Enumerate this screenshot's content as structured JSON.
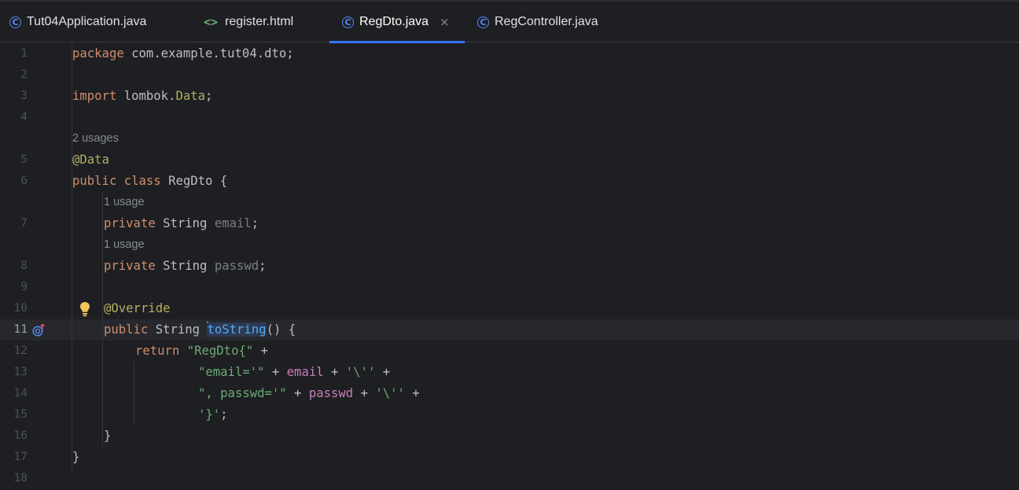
{
  "tabs": [
    {
      "label": "Tut04Application.java",
      "icon": "java-class-icon",
      "active": false
    },
    {
      "label": "register.html",
      "icon": "html-file-icon",
      "active": false
    },
    {
      "label": "RegDto.java",
      "icon": "java-class-icon",
      "active": true,
      "close": "×"
    },
    {
      "label": "RegController.java",
      "icon": "java-class-icon",
      "active": false
    }
  ],
  "class_icon_glyph": "C",
  "html_icon_glyph": "<>",
  "editor": {
    "current_line": 11,
    "line_numbers": [
      "1",
      "2",
      "3",
      "4",
      "5",
      "6",
      "7",
      "8",
      "9",
      "10",
      "11",
      "12",
      "13",
      "14",
      "15",
      "16",
      "17",
      "18"
    ],
    "hints": {
      "class_usages": "2 usages",
      "email_usages": "1 usage",
      "passwd_usages": "1 usage"
    },
    "code": {
      "l1": {
        "kw": "package",
        "rest": " com.example.tut04.dto;"
      },
      "l3": {
        "kw": "import",
        "pkg": " lombok.",
        "cls": "Data",
        "end": ";"
      },
      "l5": {
        "ann": "@Data"
      },
      "l6": {
        "kw1": "public",
        "kw2": " class",
        "rest": " RegDto {"
      },
      "l7": {
        "kw": "private",
        "type": " String ",
        "name": "email",
        "end": ";"
      },
      "l8": {
        "kw": "private",
        "type": " String ",
        "name": "passwd",
        "end": ";"
      },
      "l10": {
        "ann": "@Override"
      },
      "l11": {
        "kw": "public",
        "type": " String ",
        "meth": "toString",
        "end": "() {"
      },
      "l12": {
        "kw": "return",
        "sp": " ",
        "str": "\"RegDto{\"",
        "end": " +"
      },
      "l13": {
        "str": "\"email='\"",
        "op1": " + ",
        "fld": "email",
        "op2": " + ",
        "str2": "'\\''",
        "end": " +"
      },
      "l14": {
        "str": "\", passwd='\"",
        "op1": " + ",
        "fld": "passwd",
        "op2": " + ",
        "str2": "'\\''",
        "end": " +"
      },
      "l15": {
        "str": "'}'",
        "end": ";"
      },
      "l16": {
        "text": "}"
      },
      "l17": {
        "text": "}"
      }
    }
  },
  "colors": {
    "background": "#1e1f22",
    "keyword": "#cf8e6d",
    "annotation": "#b3ae60",
    "string": "#6aab73",
    "field": "#c77dbb",
    "method": "#56a8f5",
    "accent": "#3574f0"
  }
}
